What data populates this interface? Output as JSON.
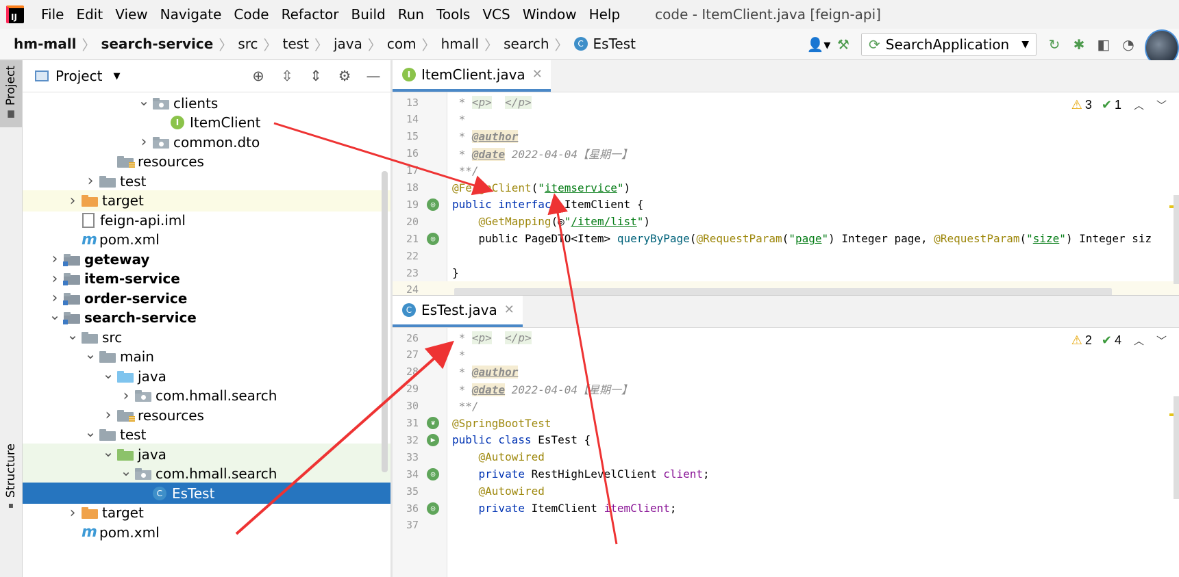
{
  "menubar": {
    "items": [
      "File",
      "Edit",
      "View",
      "Navigate",
      "Code",
      "Refactor",
      "Build",
      "Run",
      "Tools",
      "VCS",
      "Window",
      "Help"
    ],
    "window_title": "code - ItemClient.java [feign-api]"
  },
  "breadcrumbs": [
    "hm-mall",
    "search-service",
    "src",
    "test",
    "java",
    "com",
    "hmall",
    "search",
    "EsTest"
  ],
  "toolbar": {
    "run_config": "SearchApplication",
    "icons": [
      "user-icon",
      "build-hammer-icon",
      "rerun-icon",
      "debug-bug-icon",
      "coverage-icon",
      "profile-icon"
    ]
  },
  "left_stripe": {
    "project_label": "Project",
    "structure_label": "Structure"
  },
  "project_panel": {
    "title": "Project",
    "actions": [
      "locate-icon",
      "expand-all-icon",
      "collapse-all-icon",
      "gear-icon",
      "minimize-icon"
    ]
  },
  "tree": [
    {
      "label": "clients",
      "icon": "folder-package",
      "arrow": "expanded",
      "indent": 7,
      "hl": ""
    },
    {
      "label": "ItemClient",
      "icon": "interface",
      "arrow": "",
      "indent": 8,
      "hl": ""
    },
    {
      "label": "common.dto",
      "icon": "folder-package",
      "arrow": "collapsed",
      "indent": 7,
      "hl": ""
    },
    {
      "label": "resources",
      "icon": "folder-resources",
      "arrow": "",
      "indent": 5,
      "hl": ""
    },
    {
      "label": "test",
      "icon": "folder",
      "arrow": "collapsed",
      "indent": 4,
      "hl": ""
    },
    {
      "label": "target",
      "icon": "folder-orange",
      "arrow": "collapsed",
      "indent": 3,
      "hl": "yellow"
    },
    {
      "label": "feign-api.iml",
      "icon": "file-iml",
      "arrow": "",
      "indent": 3,
      "hl": ""
    },
    {
      "label": "pom.xml",
      "icon": "maven",
      "arrow": "",
      "indent": 3,
      "hl": ""
    },
    {
      "label": "geteway",
      "icon": "folder-module",
      "arrow": "collapsed",
      "indent": 2,
      "bold": true,
      "hl": ""
    },
    {
      "label": "item-service",
      "icon": "folder-module",
      "arrow": "collapsed",
      "indent": 2,
      "bold": true,
      "hl": ""
    },
    {
      "label": "order-service",
      "icon": "folder-module",
      "arrow": "collapsed",
      "indent": 2,
      "bold": true,
      "hl": ""
    },
    {
      "label": "search-service",
      "icon": "folder-module",
      "arrow": "expanded",
      "indent": 2,
      "bold": true,
      "hl": ""
    },
    {
      "label": "src",
      "icon": "folder",
      "arrow": "expanded",
      "indent": 3,
      "hl": ""
    },
    {
      "label": "main",
      "icon": "folder",
      "arrow": "expanded",
      "indent": 4,
      "hl": ""
    },
    {
      "label": "java",
      "icon": "folder-blue",
      "arrow": "expanded",
      "indent": 5,
      "hl": ""
    },
    {
      "label": "com.hmall.search",
      "icon": "folder-package",
      "arrow": "collapsed",
      "indent": 6,
      "hl": ""
    },
    {
      "label": "resources",
      "icon": "folder-resources",
      "arrow": "collapsed",
      "indent": 5,
      "hl": ""
    },
    {
      "label": "test",
      "icon": "folder",
      "arrow": "expanded",
      "indent": 4,
      "hl": ""
    },
    {
      "label": "java",
      "icon": "folder-green",
      "arrow": "expanded",
      "indent": 5,
      "hl": "green"
    },
    {
      "label": "com.hmall.search",
      "icon": "folder-package",
      "arrow": "expanded",
      "indent": 6,
      "hl": "green"
    },
    {
      "label": "EsTest",
      "icon": "class",
      "arrow": "",
      "indent": 7,
      "hl": "selected"
    },
    {
      "label": "target",
      "icon": "folder-orange",
      "arrow": "collapsed",
      "indent": 3,
      "hl": ""
    },
    {
      "label": "pom.xml",
      "icon": "maven",
      "arrow": "",
      "indent": 3,
      "hl": ""
    }
  ],
  "editor_top": {
    "tab": "ItemClient.java",
    "warnings": "3",
    "checks": "1",
    "lines": [
      {
        "n": "13",
        "g": "",
        "t": [
          [
            "c-com",
            " * "
          ],
          [
            "c-tag",
            "<p>"
          ],
          [
            "c-com",
            "  "
          ],
          [
            "c-tag",
            "</p>"
          ]
        ]
      },
      {
        "n": "14",
        "g": "",
        "t": [
          [
            "c-com",
            " *"
          ]
        ]
      },
      {
        "n": "15",
        "g": "",
        "t": [
          [
            "c-com",
            " * "
          ],
          [
            "c-doc",
            "@author"
          ]
        ]
      },
      {
        "n": "16",
        "g": "",
        "t": [
          [
            "c-com",
            " * "
          ],
          [
            "c-doc",
            "@date"
          ],
          [
            "c-com",
            " 2022-04-04【星期一】"
          ]
        ]
      },
      {
        "n": "17",
        "g": "",
        "t": [
          [
            "c-com",
            " **/"
          ]
        ]
      },
      {
        "n": "18",
        "g": "",
        "t": [
          [
            "c-ann",
            "@FeignClient"
          ],
          [
            "",
            "("
          ],
          [
            "c-str",
            "\""
          ],
          [
            "c-str c-und",
            "itemservice"
          ],
          [
            "c-str",
            "\""
          ],
          [
            "",
            ")"
          ]
        ]
      },
      {
        "n": "19",
        "g": "i",
        "t": [
          [
            "c-kw",
            "public interface "
          ],
          [
            "",
            "ItemClient {"
          ]
        ]
      },
      {
        "n": "20",
        "g": "",
        "t": [
          [
            "",
            "    "
          ],
          [
            "c-ann",
            "@GetMapping"
          ],
          [
            "",
            "(◎"
          ],
          [
            "c-str",
            "\""
          ],
          [
            "c-str c-und",
            "/item/list"
          ],
          [
            "c-str",
            "\""
          ],
          [
            "",
            ")"
          ]
        ]
      },
      {
        "n": "21",
        "g": "i",
        "t": [
          [
            "",
            "    public PageDTO<Item> "
          ],
          [
            "c-fn",
            "queryByPage"
          ],
          [
            "",
            "("
          ],
          [
            "c-ann",
            "@RequestParam"
          ],
          [
            "",
            "("
          ],
          [
            "c-str",
            "\""
          ],
          [
            "c-str c-und",
            "page"
          ],
          [
            "c-str",
            "\""
          ],
          [
            "",
            ") Integer page, "
          ],
          [
            "c-ann",
            "@RequestParam"
          ],
          [
            "",
            "("
          ],
          [
            "c-str",
            "\""
          ],
          [
            "c-str c-und",
            "size"
          ],
          [
            "c-str",
            "\""
          ],
          [
            "",
            ") Integer siz"
          ]
        ]
      },
      {
        "n": "22",
        "g": "",
        "t": []
      },
      {
        "n": "23",
        "g": "",
        "t": [
          [
            "",
            "}"
          ]
        ]
      },
      {
        "n": "24",
        "g": "",
        "t": []
      }
    ]
  },
  "editor_bottom": {
    "tab": "EsTest.java",
    "warnings": "2",
    "checks": "4",
    "lines": [
      {
        "n": "26",
        "g": "",
        "t": [
          [
            "c-com",
            " * "
          ],
          [
            "c-tag",
            "<p>"
          ],
          [
            "c-com",
            "  "
          ],
          [
            "c-tag",
            "</p>"
          ]
        ]
      },
      {
        "n": "27",
        "g": "",
        "t": [
          [
            "c-com",
            " *"
          ]
        ]
      },
      {
        "n": "28",
        "g": "",
        "t": [
          [
            "c-com",
            " * "
          ],
          [
            "c-doc",
            "@author"
          ]
        ]
      },
      {
        "n": "29",
        "g": "",
        "t": [
          [
            "c-com",
            " * "
          ],
          [
            "c-doc",
            "@date"
          ],
          [
            "c-com",
            " 2022-04-04【星期一】"
          ]
        ]
      },
      {
        "n": "30",
        "g": "",
        "t": [
          [
            "c-com",
            " **/"
          ]
        ]
      },
      {
        "n": "31",
        "g": "s",
        "t": [
          [
            "c-ann",
            "@SpringBootTest"
          ]
        ]
      },
      {
        "n": "32",
        "g": "r",
        "t": [
          [
            "c-kw",
            "public class "
          ],
          [
            "",
            "EsTest {"
          ]
        ]
      },
      {
        "n": "33",
        "g": "",
        "t": [
          [
            "",
            "    "
          ],
          [
            "c-ann",
            "@Autowired"
          ]
        ]
      },
      {
        "n": "34",
        "g": "i",
        "t": [
          [
            "",
            "    "
          ],
          [
            "c-kw",
            "private "
          ],
          [
            "",
            "RestHighLevelClient "
          ],
          [
            "c-fld",
            "client"
          ],
          [
            "",
            ";"
          ]
        ]
      },
      {
        "n": "35",
        "g": "",
        "t": [
          [
            "",
            "    "
          ],
          [
            "c-ann",
            "@Autowired"
          ]
        ]
      },
      {
        "n": "36",
        "g": "i",
        "t": [
          [
            "",
            "    "
          ],
          [
            "c-kw",
            "private "
          ],
          [
            "",
            "ItemClient "
          ],
          [
            "c-fld",
            "itemClient"
          ],
          [
            "",
            ";"
          ]
        ]
      },
      {
        "n": "37",
        "g": "",
        "t": []
      }
    ]
  },
  "colors": {
    "arrow": "#ee3333",
    "selection": "#2675bf",
    "accent": "#4a88c7"
  }
}
